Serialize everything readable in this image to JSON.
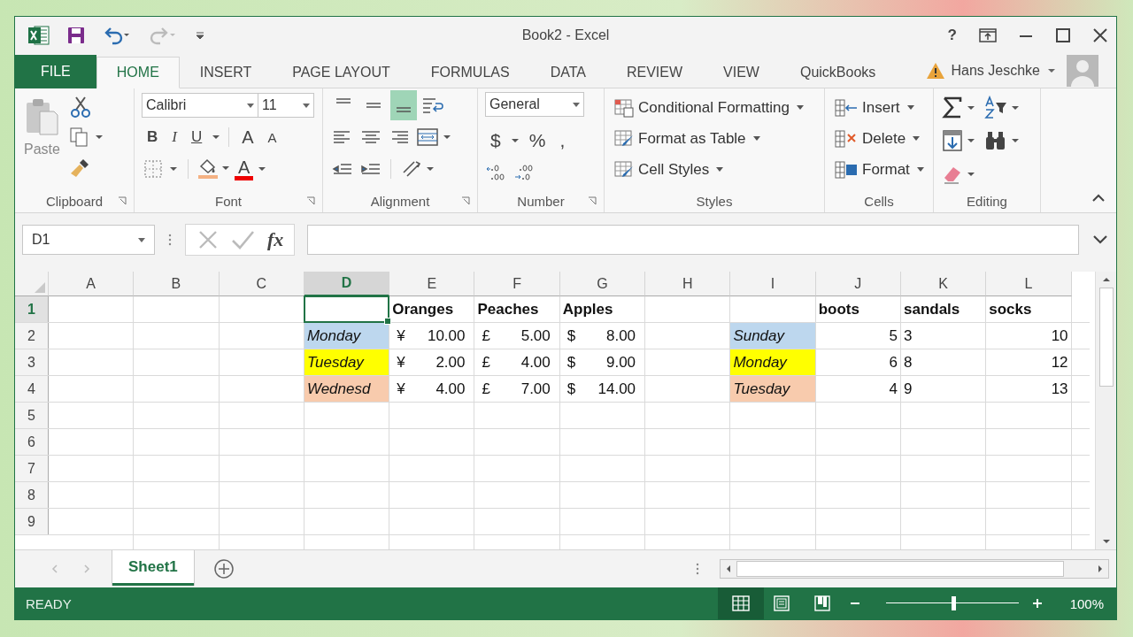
{
  "window": {
    "title": "Book2 - Excel",
    "help": "?"
  },
  "tabs": [
    {
      "label": "FILE",
      "kind": "file",
      "selected": false
    },
    {
      "label": "HOME",
      "kind": "tab",
      "selected": true
    },
    {
      "label": "INSERT",
      "kind": "tab",
      "selected": false
    },
    {
      "label": "PAGE LAYOUT",
      "kind": "tab",
      "selected": false
    },
    {
      "label": "FORMULAS",
      "kind": "tab",
      "selected": false
    },
    {
      "label": "DATA",
      "kind": "tab",
      "selected": false
    },
    {
      "label": "REVIEW",
      "kind": "tab",
      "selected": false
    },
    {
      "label": "VIEW",
      "kind": "tab",
      "selected": false
    },
    {
      "label": "QuickBooks",
      "kind": "tab",
      "selected": false
    }
  ],
  "user": {
    "name": "Hans Jeschke"
  },
  "ribbon": {
    "clipboard": {
      "label": "Clipboard",
      "paste": "Paste"
    },
    "font": {
      "label": "Font",
      "font_name": "Calibri",
      "font_size": "11",
      "bold": "B",
      "italic": "I",
      "underline": "U",
      "grow": "A",
      "shrink": "A",
      "font_color": "A"
    },
    "alignment": {
      "label": "Alignment",
      "buttons": [
        {
          "kind": "top",
          "selected": false
        },
        {
          "kind": "middle",
          "selected": false
        },
        {
          "kind": "bottom",
          "selected": true
        }
      ]
    },
    "number": {
      "label": "Number",
      "format": "General",
      "currency": "$",
      "percent": "%",
      "comma": ","
    },
    "styles": {
      "label": "Styles",
      "buttons": [
        "Conditional Formatting",
        "Format as Table",
        "Cell Styles"
      ]
    },
    "cells": {
      "label": "Cells",
      "buttons": [
        "Insert",
        "Delete",
        "Format"
      ]
    },
    "editing": {
      "label": "Editing"
    }
  },
  "formula_bar": {
    "name_box": "D1",
    "fx": "fx"
  },
  "grid": {
    "columns": [
      {
        "label": "A",
        "selected": false
      },
      {
        "label": "B",
        "selected": false
      },
      {
        "label": "C",
        "selected": false
      },
      {
        "label": "D",
        "selected": true
      },
      {
        "label": "E",
        "selected": false
      },
      {
        "label": "F",
        "selected": false
      },
      {
        "label": "G",
        "selected": false
      },
      {
        "label": "H",
        "selected": false
      },
      {
        "label": "I",
        "selected": false
      },
      {
        "label": "J",
        "selected": false
      },
      {
        "label": "K",
        "selected": false
      },
      {
        "label": "L",
        "selected": false
      }
    ],
    "rows": [
      {
        "label": "1",
        "selected": true,
        "cells": {
          "E": {
            "kind": "header",
            "text": "Oranges"
          },
          "F": {
            "kind": "header",
            "text": "Peaches"
          },
          "G": {
            "kind": "header",
            "text": "Apples"
          },
          "J": {
            "kind": "header",
            "text": "boots"
          },
          "K": {
            "kind": "header",
            "text": "sandals"
          },
          "L": {
            "kind": "header",
            "text": "socks"
          }
        }
      },
      {
        "label": "2",
        "selected": false,
        "cells": {
          "D": {
            "kind": "day",
            "text": "Monday",
            "color": "#bdd7ee"
          },
          "E": {
            "kind": "currency",
            "symbol": "¥",
            "text": "10.00"
          },
          "F": {
            "kind": "currency",
            "symbol": "£",
            "text": "5.00"
          },
          "G": {
            "kind": "currency",
            "symbol": "$",
            "text": "8.00"
          },
          "I": {
            "kind": "day",
            "text": "Sunday",
            "color": "#bdd7ee"
          },
          "J": {
            "kind": "number",
            "text": "5"
          },
          "K": {
            "kind": "text",
            "text": "3"
          },
          "L": {
            "kind": "number",
            "text": "10"
          }
        }
      },
      {
        "label": "3",
        "selected": false,
        "cells": {
          "D": {
            "kind": "day",
            "text": "Tuesday",
            "color": "#ffff00"
          },
          "E": {
            "kind": "currency",
            "symbol": "¥",
            "text": "2.00"
          },
          "F": {
            "kind": "currency",
            "symbol": "£",
            "text": "4.00"
          },
          "G": {
            "kind": "currency",
            "symbol": "$",
            "text": "9.00"
          },
          "I": {
            "kind": "day",
            "text": "Monday",
            "color": "#ffff00"
          },
          "J": {
            "kind": "number",
            "text": "6"
          },
          "K": {
            "kind": "text",
            "text": "8"
          },
          "L": {
            "kind": "number",
            "text": "12"
          }
        }
      },
      {
        "label": "4",
        "selected": false,
        "cells": {
          "D": {
            "kind": "day",
            "text": "Wednesd",
            "color": "#f8cbad"
          },
          "E": {
            "kind": "currency",
            "symbol": "¥",
            "text": "4.00"
          },
          "F": {
            "kind": "currency",
            "symbol": "£",
            "text": "7.00"
          },
          "G": {
            "kind": "currency",
            "symbol": "$",
            "text": "14.00"
          },
          "I": {
            "kind": "day",
            "text": "Tuesday",
            "color": "#f8cbad"
          },
          "J": {
            "kind": "number",
            "text": "4"
          },
          "K": {
            "kind": "text",
            "text": "9"
          },
          "L": {
            "kind": "number",
            "text": "13"
          }
        }
      },
      {
        "label": "5",
        "selected": false,
        "cells": {}
      },
      {
        "label": "6",
        "selected": false,
        "cells": {}
      },
      {
        "label": "7",
        "selected": false,
        "cells": {}
      },
      {
        "label": "8",
        "selected": false,
        "cells": {}
      },
      {
        "label": "9",
        "selected": false,
        "cells": {}
      }
    ]
  },
  "sheets": [
    {
      "label": "Sheet1",
      "selected": true
    }
  ],
  "status_bar": {
    "status": "READY",
    "views": [
      {
        "kind": "normal",
        "selected": true
      },
      {
        "kind": "page_layout",
        "selected": false
      },
      {
        "kind": "page_break",
        "selected": false
      }
    ],
    "zoom": {
      "level": 0.51,
      "reading": "100%"
    }
  }
}
